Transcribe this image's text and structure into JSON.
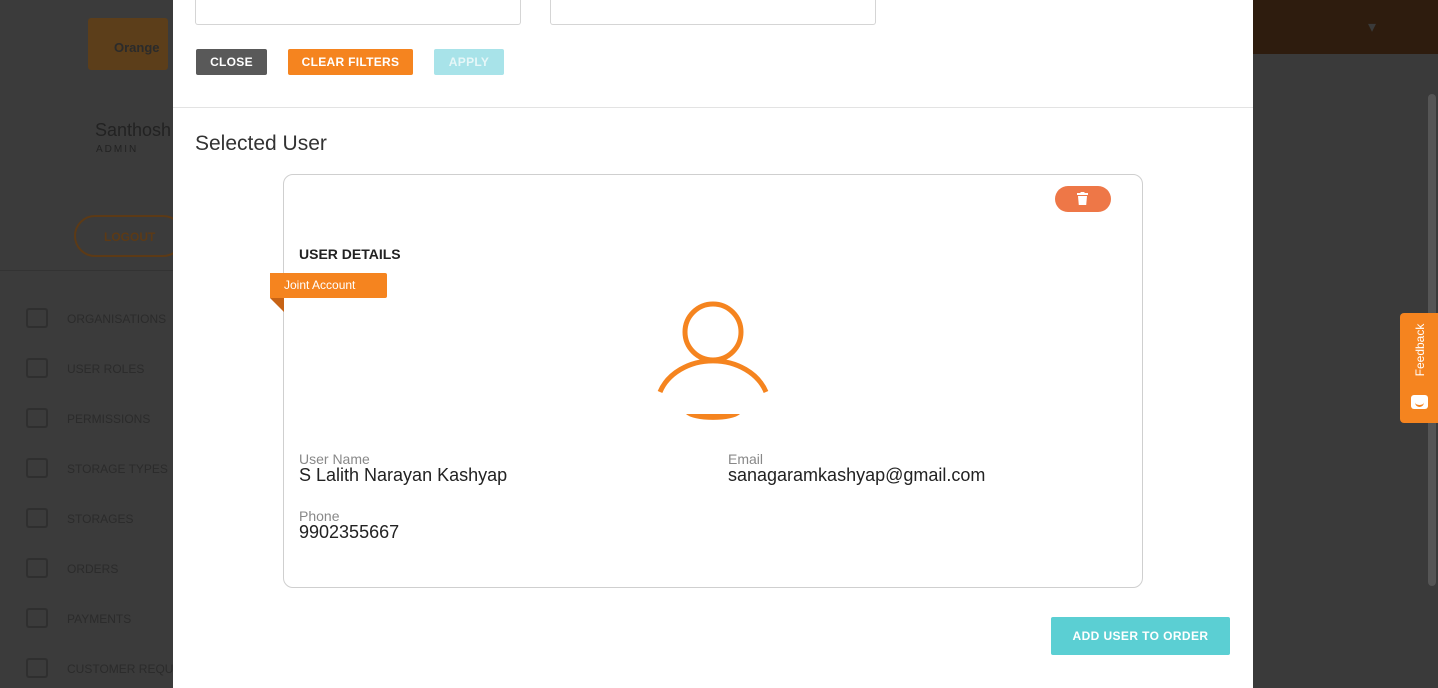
{
  "background": {
    "logo_text": "Orange",
    "user_name": "Santhosh",
    "user_role": "ADMIN",
    "logout_label": "LOGOUT",
    "nav": [
      {
        "label": "ORGANISATIONS",
        "icon": "briefcase-icon"
      },
      {
        "label": "USER ROLES",
        "icon": "graduation-cap-icon"
      },
      {
        "label": "PERMISSIONS",
        "icon": "glasses-icon"
      },
      {
        "label": "STORAGE TYPES",
        "icon": "archive-icon"
      },
      {
        "label": "STORAGES",
        "icon": "key-icon"
      },
      {
        "label": "ORDERS",
        "icon": "cart-icon"
      },
      {
        "label": "PAYMENTS",
        "icon": "card-icon"
      },
      {
        "label": "CUSTOMER REQU",
        "icon": "list-icon"
      }
    ],
    "bell_icon": "bell-icon"
  },
  "feedback": {
    "label": "Feedback",
    "icon": "chat-icon"
  },
  "filters": {
    "close_label": "CLOSE",
    "clear_label": "CLEAR FILTERS",
    "apply_label": "APPLY"
  },
  "selected_user": {
    "title": "Selected User",
    "card_heading": "USER DETAILS",
    "badge": "Joint Account",
    "delete_icon": "trash-icon",
    "avatar_icon": "user-avatar-icon",
    "fields": {
      "user_name_label": "User Name",
      "user_name_value": "S Lalith Narayan Kashyap",
      "email_label": "Email",
      "email_value": "sanagaramkashyap@gmail.com",
      "phone_label": "Phone",
      "phone_value": "9902355667"
    }
  },
  "add_button_label": "ADD USER TO ORDER",
  "colors": {
    "accent_orange": "#f5841f",
    "delete_red": "#ee7747",
    "teal": "#5bcfd3",
    "close_gray": "#595959"
  }
}
